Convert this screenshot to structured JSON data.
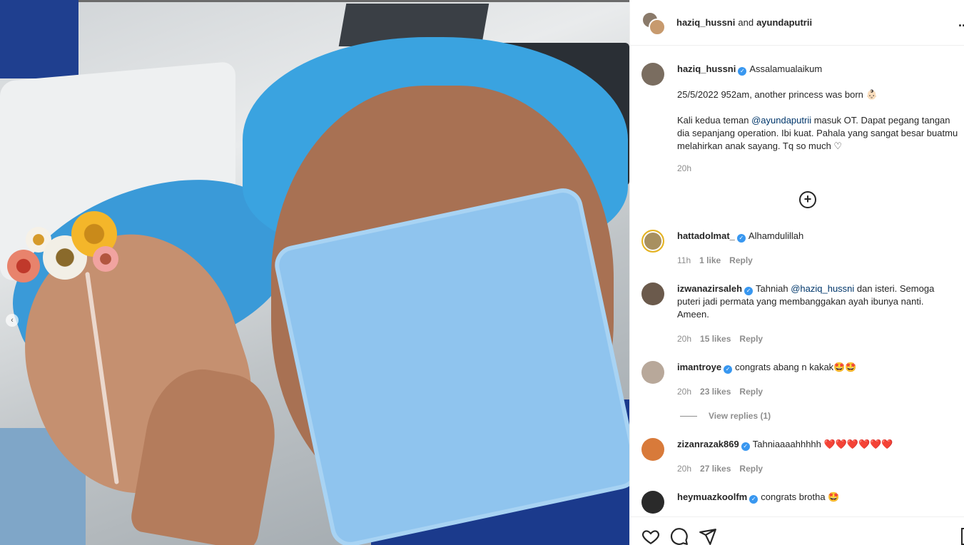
{
  "header": {
    "user1": "haziq_hussni",
    "joiner": "and",
    "user2": "ayundaputrii",
    "more": "..."
  },
  "caption": {
    "username": "haziq_hussni",
    "first_line": "Assalamualaikum",
    "line2": "25/5/2022 952am, another princess was born 👶🏻",
    "line3_pre": "Kali kedua teman ",
    "line3_mention": "@ayundaputrii",
    "line3_post": " masuk OT. Dapat pegang tangan",
    "line4": "dia sepanjang operation. Ibi kuat. Pahala yang sangat besar buatmu",
    "line5": "melahirkan anak sayang. Tq so much ♡",
    "time": "20h"
  },
  "comments": [
    {
      "username": "hattadolmat_",
      "text": "Alhamdulillah",
      "time": "11h",
      "likes": "1 like",
      "reply": "Reply"
    },
    {
      "username": "izwanazirsaleh",
      "text_pre": "Tahniah ",
      "mention": "@haziq_hussni",
      "text_post": " dan isteri. Semoga",
      "line2": "puteri jadi permata yang membanggakan ayah ibunya nanti.",
      "line3": "Ameen.",
      "time": "20h",
      "likes": "15 likes",
      "reply": "Reply"
    },
    {
      "username": "imantroye",
      "text": "congrats abang n kakak🤩🤩",
      "time": "20h",
      "likes": "23 likes",
      "reply": "Reply",
      "view_replies": "View replies (1)"
    },
    {
      "username": "zizanrazak869",
      "text": "Tahniaaaahhhhh ❤️❤️❤️❤️❤️❤️",
      "time": "20h",
      "likes": "27 likes",
      "reply": "Reply"
    },
    {
      "username": "heymuazkoolfm",
      "text": "congrats brotha 🤩"
    }
  ],
  "actions": {
    "like_icon": "heart-icon",
    "comment_icon": "comment-icon",
    "share_icon": "share-icon",
    "save_icon": "bookmark-icon"
  },
  "colors": {
    "verified": "#3897f0",
    "mention": "#00376b",
    "meta": "#8e8e8e"
  }
}
